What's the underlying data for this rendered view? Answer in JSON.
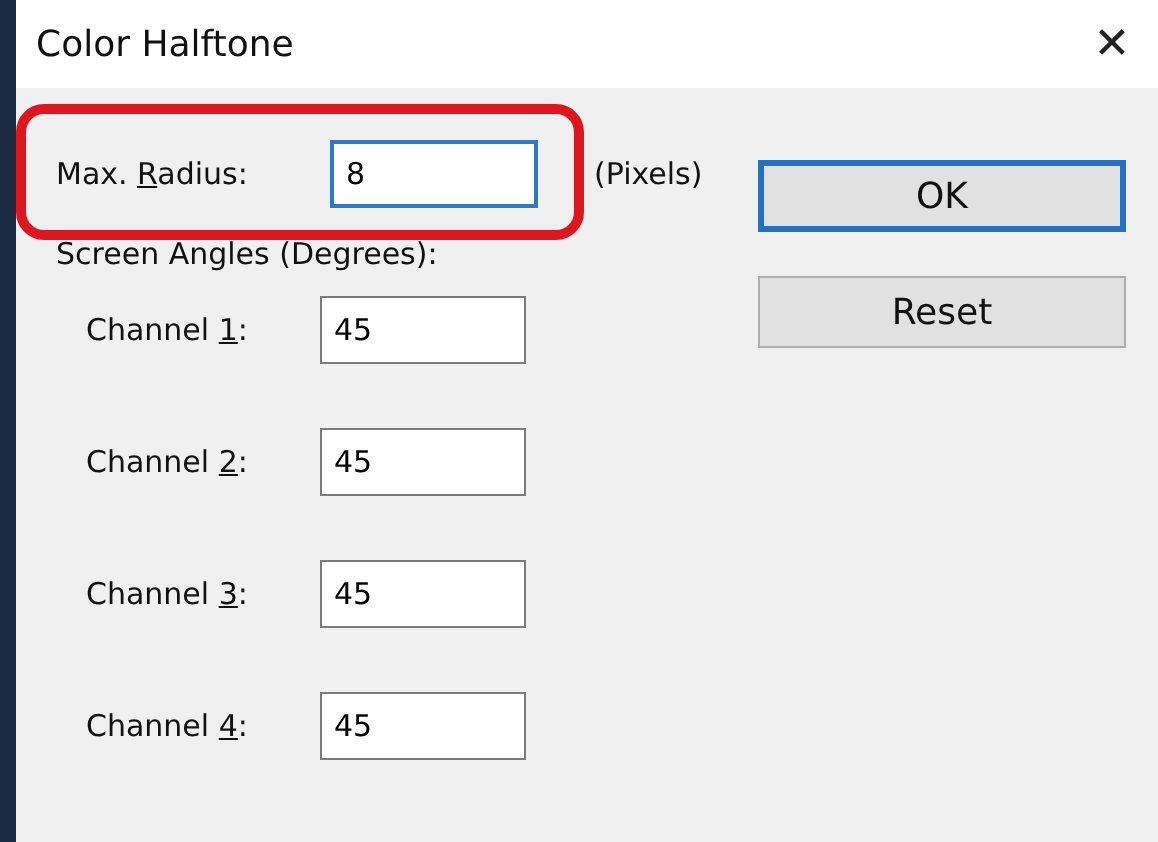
{
  "window": {
    "title": "Color Halftone",
    "close": "✕"
  },
  "radius": {
    "label_before": "Max. ",
    "access_key": "R",
    "label_after": "adius:",
    "value": "8",
    "focused": true,
    "unit": "(Pixels)",
    "highlighted": true
  },
  "angles_heading": "Screen Angles (Degrees):",
  "channels": [
    {
      "label_before": "Channel ",
      "access_key": "1",
      "label_after": ":",
      "value": "45",
      "focused": false
    },
    {
      "label_before": "Channel ",
      "access_key": "2",
      "label_after": ":",
      "value": "45",
      "focused": false
    },
    {
      "label_before": "Channel ",
      "access_key": "3",
      "label_after": ":",
      "value": "45",
      "focused": false
    },
    {
      "label_before": "Channel ",
      "access_key": "4",
      "label_after": ":",
      "value": "45",
      "focused": false
    }
  ],
  "buttons": [
    {
      "label": "OK",
      "default": true
    },
    {
      "label": "Reset",
      "default": false
    }
  ]
}
